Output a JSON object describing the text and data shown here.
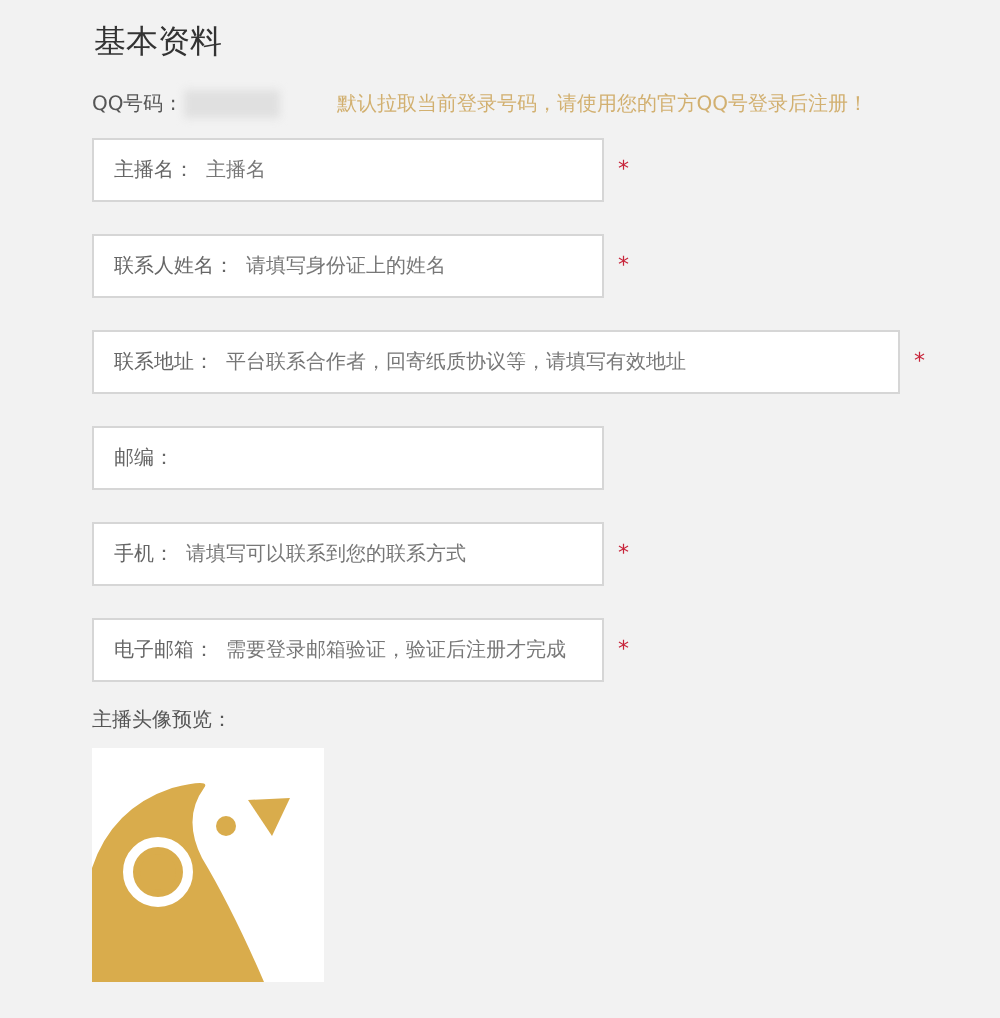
{
  "title": "基本资料",
  "qq": {
    "label": "QQ号码 :",
    "hint": "默认拉取当前登录号码，请使用您的官方QQ号登录后注册！"
  },
  "required_mark": "*",
  "fields": [
    {
      "kind": "short",
      "label": "主播名：",
      "placeholder": "主播名",
      "required": true
    },
    {
      "kind": "short",
      "label": "联系人姓名：",
      "placeholder": "请填写身份证上的姓名",
      "required": true
    },
    {
      "kind": "long",
      "label": "联系地址：",
      "placeholder": "平台联系合作者，回寄纸质协议等，请填写有效地址",
      "required": true
    },
    {
      "kind": "short",
      "label": "邮编：",
      "required": false
    },
    {
      "kind": "short",
      "label": "手机：",
      "placeholder": "请填写可以联系到您的联系方式",
      "required": true
    },
    {
      "kind": "short",
      "label": "电子邮箱：",
      "placeholder": "需要登录邮箱验证，验证后注册才完成",
      "required": true
    }
  ],
  "avatar": {
    "label": "主播头像预览："
  }
}
